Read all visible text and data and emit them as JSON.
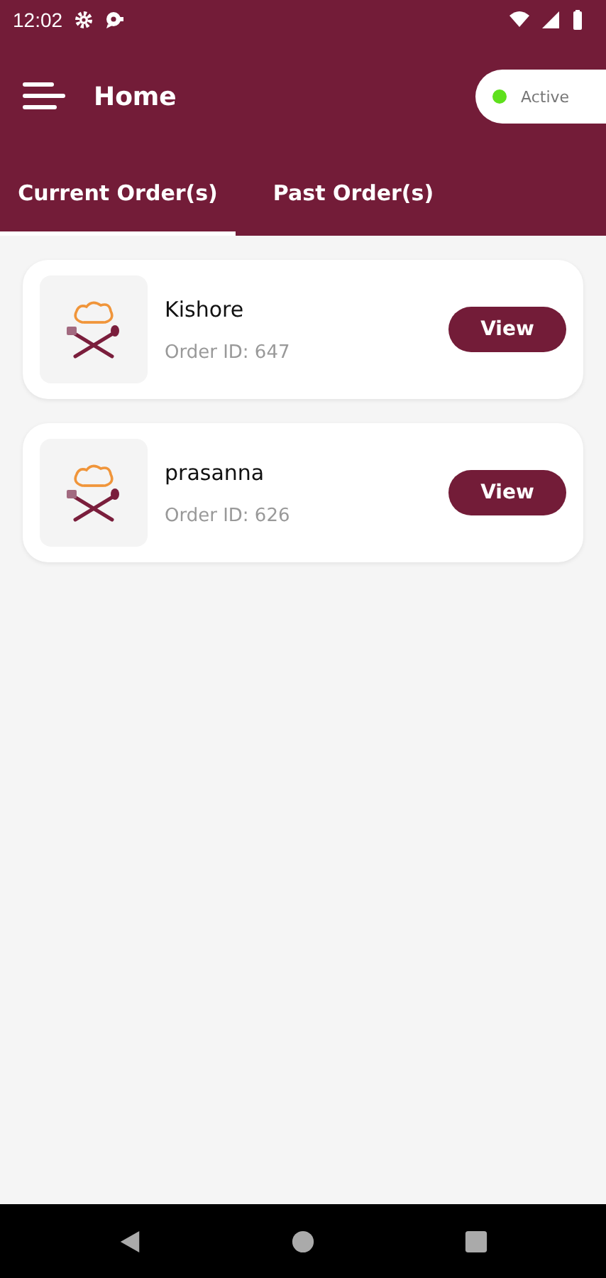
{
  "status_bar": {
    "time": "12:02"
  },
  "app_bar": {
    "title": "Home",
    "availability": {
      "label": "Active",
      "on": true
    }
  },
  "tabs": [
    {
      "label": "Current Order(s)",
      "selected": true
    },
    {
      "label": "Past Order(s)",
      "selected": false
    }
  ],
  "orders": [
    {
      "name": "Kishore",
      "order_id": "Order ID: 647",
      "button": "View"
    },
    {
      "name": "prasanna",
      "order_id": "Order ID: 626",
      "button": "View"
    }
  ]
}
